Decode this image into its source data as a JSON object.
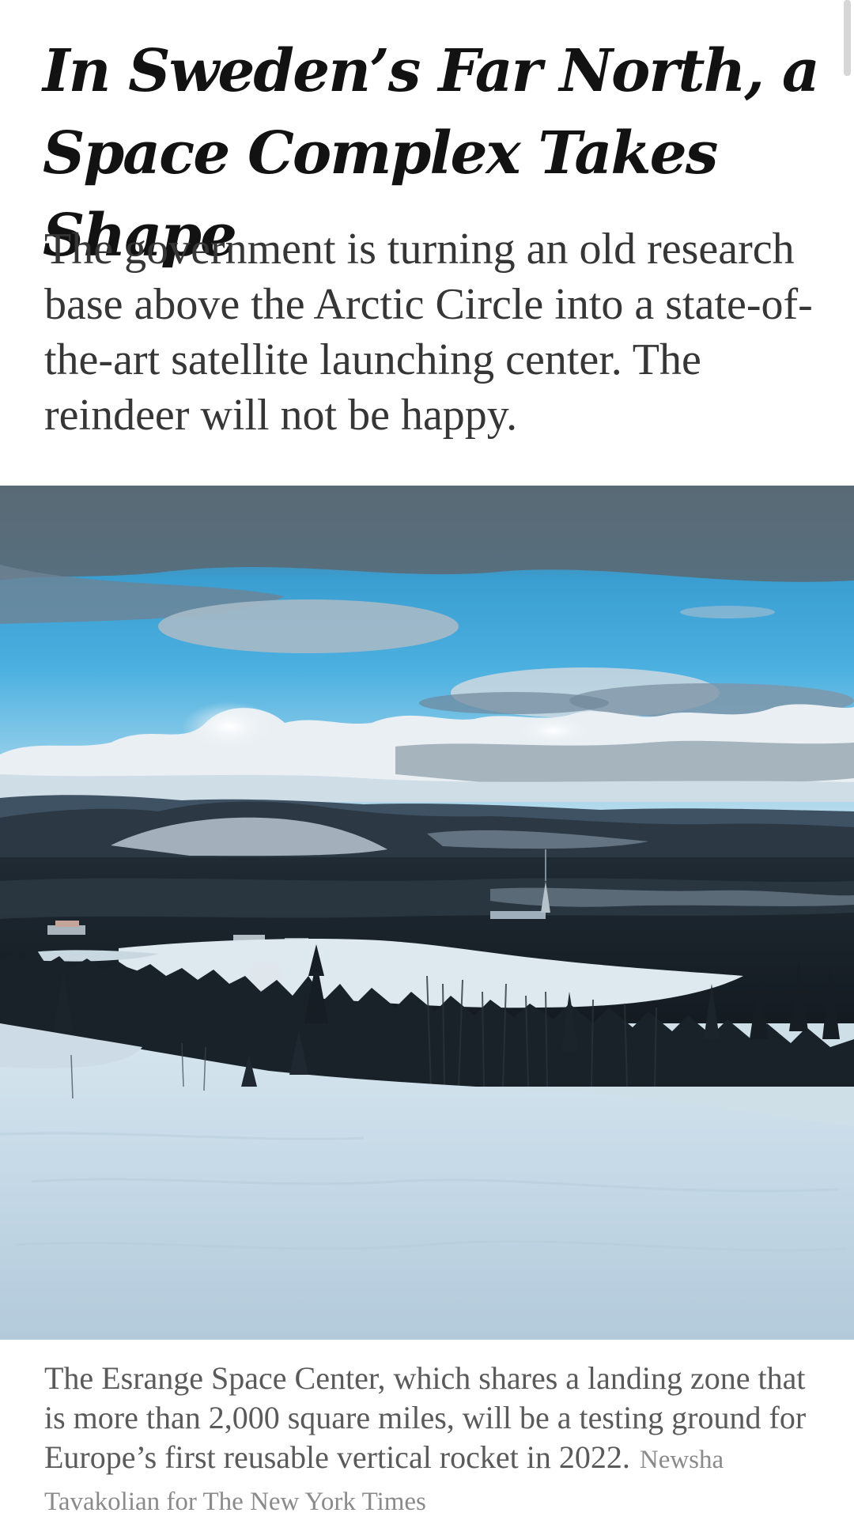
{
  "article": {
    "headline": "In Sweden’s Far North, a Space Complex Takes Shape",
    "summary": "The government is turning an old research base above the Arctic Circle into a state-of-the-art satellite launching center. The reindeer will not be happy.",
    "image": {
      "caption": "The Esrange Space Center, which shares a landing zone that is more than 2,000 square miles, will be a testing ground for Europe’s first reusable vertical rocket in 2022.",
      "credit": "Newsha Tavakolian for The New York Times"
    }
  },
  "colors": {
    "headline": "#121212",
    "summary": "#363636",
    "caption": "#5a5a5a",
    "credit": "#8a8a8a"
  }
}
